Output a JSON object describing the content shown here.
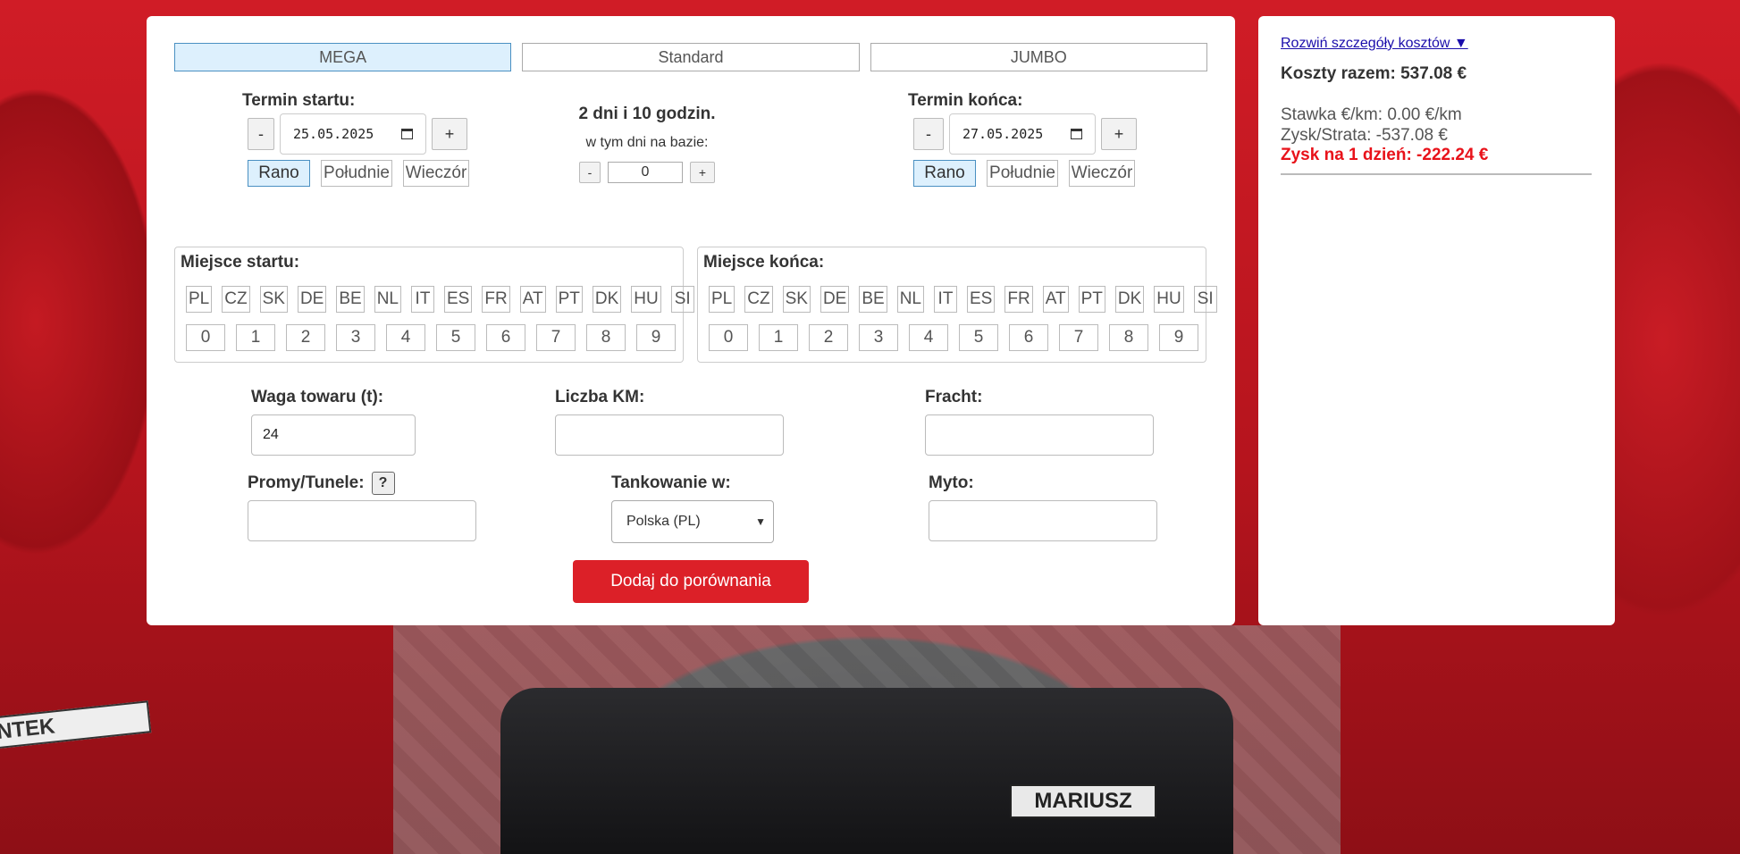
{
  "tabs": [
    {
      "label": "MEGA",
      "active": true
    },
    {
      "label": "Standard",
      "active": false
    },
    {
      "label": "JUMBO",
      "active": false
    }
  ],
  "start": {
    "label": "Termin startu:",
    "minus": "-",
    "date": "25.05.2025",
    "plus": "+",
    "times": [
      "Rano",
      "Południe",
      "Wieczór"
    ],
    "selected_time": "Rano"
  },
  "duration": {
    "text": "2 dni i 10 godzin.",
    "base_label": "w tym dni na bazie:",
    "base_minus": "-",
    "base_value": "0",
    "base_plus": "+"
  },
  "end": {
    "label": "Termin końca:",
    "minus": "-",
    "date": "27.05.2025",
    "plus": "+",
    "times": [
      "Rano",
      "Południe",
      "Wieczór"
    ],
    "selected_time": "Rano"
  },
  "start_place": {
    "label": "Miejsce startu:",
    "countries": [
      "PL",
      "CZ",
      "SK",
      "DE",
      "BE",
      "NL",
      "IT",
      "ES",
      "FR",
      "AT",
      "PT",
      "DK",
      "HU",
      "SI"
    ],
    "digits": [
      "0",
      "1",
      "2",
      "3",
      "4",
      "5",
      "6",
      "7",
      "8",
      "9"
    ]
  },
  "end_place": {
    "label": "Miejsce końca:",
    "countries": [
      "PL",
      "CZ",
      "SK",
      "DE",
      "BE",
      "NL",
      "IT",
      "ES",
      "FR",
      "AT",
      "PT",
      "DK",
      "HU",
      "SI"
    ],
    "digits": [
      "0",
      "1",
      "2",
      "3",
      "4",
      "5",
      "6",
      "7",
      "8",
      "9"
    ]
  },
  "fields": {
    "weight": {
      "label": "Waga towaru (t):",
      "value": "24"
    },
    "km": {
      "label": "Liczba KM:",
      "value": ""
    },
    "freight": {
      "label": "Fracht:",
      "value": ""
    },
    "ferries": {
      "label": "Promy/Tunele:",
      "help": "?",
      "value": ""
    },
    "fuel": {
      "label": "Tankowanie w:",
      "selected": "Polska (PL)"
    },
    "toll": {
      "label": "Myto:",
      "value": ""
    }
  },
  "add_button": "Dodaj do porównania",
  "summary": {
    "expand_link": "Rozwiń szczegóły kosztów ▼",
    "total": "Koszty razem: 537.08 €",
    "rate": "Stawka €/km: 0.00 €/km",
    "profit_loss": "Zysk/Strata: -537.08 €",
    "profit_per_day": "Zysk na 1 dzień: -222.24 €"
  },
  "background": {
    "plate_center": "MARIUSZ",
    "plate_left": "NTEK"
  },
  "colors": {
    "accent_red": "#dc2028",
    "active_tab_bg": "#ddf0fd",
    "loss_red": "#e8121a"
  }
}
